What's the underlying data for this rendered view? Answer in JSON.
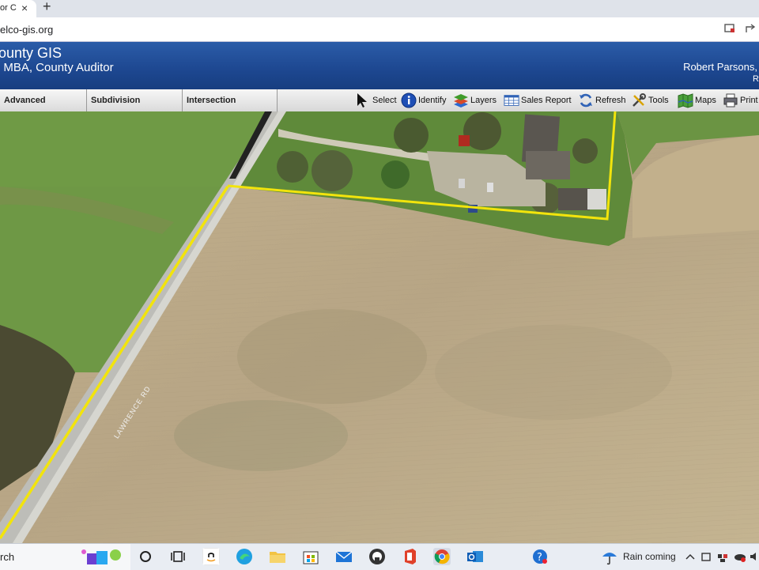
{
  "browser": {
    "tab_title": "or C",
    "tab_close": "×",
    "new_tab": "+",
    "url": "elco-gis.org"
  },
  "header": {
    "title": "ounty GIS",
    "subtitle": ", MBA, County Auditor",
    "user": "Robert Parsons,",
    "user_line2": "R"
  },
  "toolbar": {
    "search_buttons": [
      {
        "label": "Advanced Search"
      },
      {
        "label": "Subdivision Search"
      },
      {
        "label": "Intersection Search"
      }
    ],
    "caret": "▼",
    "tools": [
      {
        "label": "Select"
      },
      {
        "label": "Identify"
      },
      {
        "label": "Layers"
      },
      {
        "label": "Sales Report"
      },
      {
        "label": "Refresh"
      },
      {
        "label": "Tools"
      },
      {
        "label": "Maps"
      },
      {
        "label": "Print"
      }
    ]
  },
  "map": {
    "road_label": "LAWRENCE RD",
    "parcel_color": "#f2e40c"
  },
  "taskbar": {
    "search_text": "rch",
    "weather_text": "Rain coming"
  }
}
